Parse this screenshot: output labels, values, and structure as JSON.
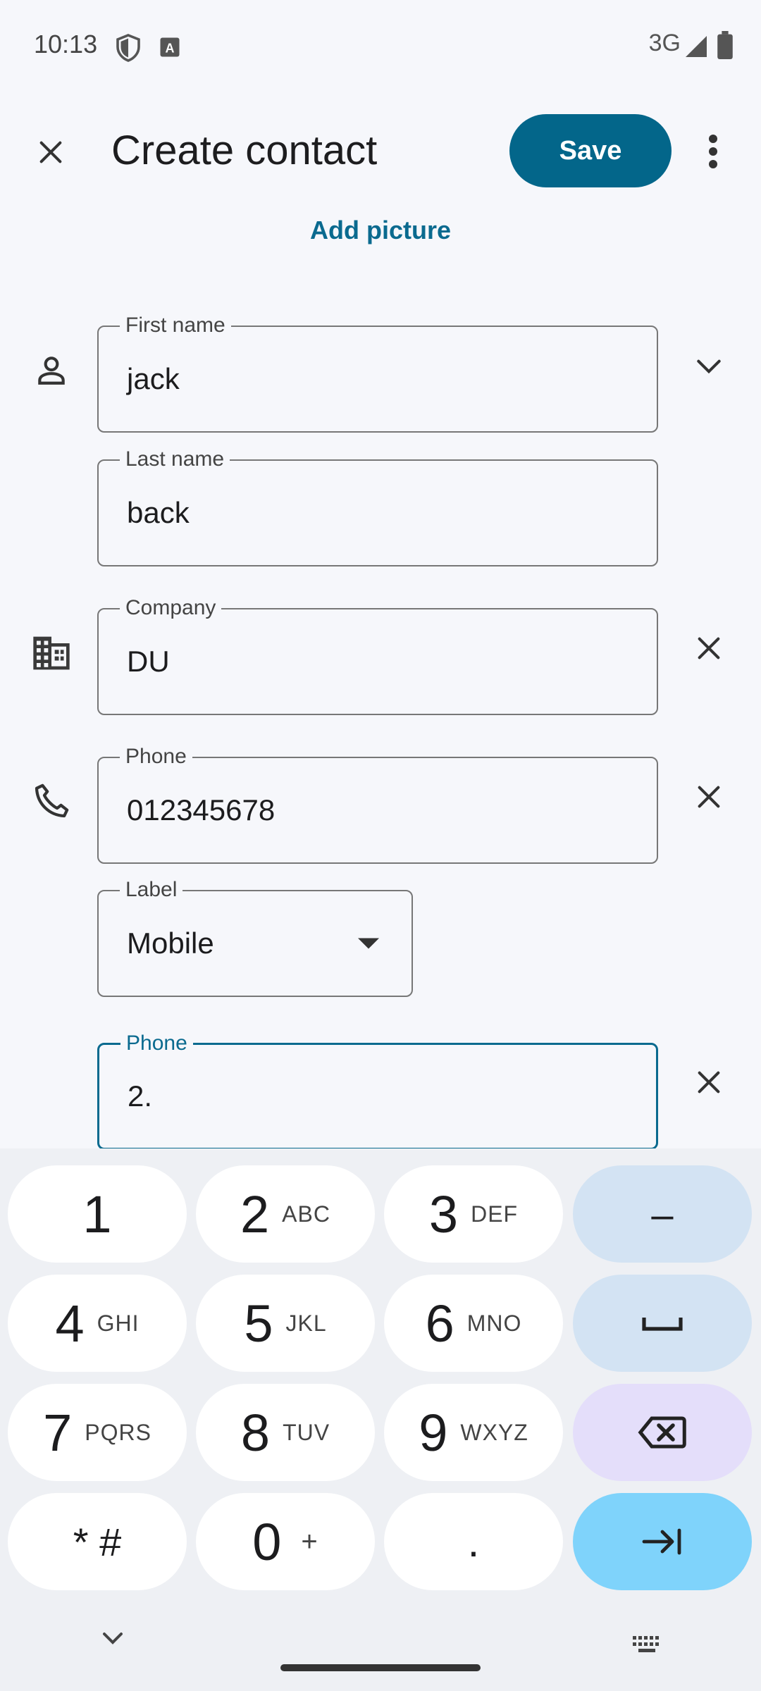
{
  "status_bar": {
    "time": "10:13",
    "network": "3G",
    "icons": [
      "shield-icon",
      "accessibility-a-icon",
      "signal-icon",
      "battery-icon"
    ]
  },
  "app_bar": {
    "title": "Create contact",
    "save_label": "Save",
    "icons": [
      "close-icon",
      "more-vert-icon"
    ]
  },
  "add_picture_label": "Add picture",
  "form": {
    "first_name": {
      "label": "First name",
      "value": "jack"
    },
    "last_name": {
      "label": "Last name",
      "value": "back"
    },
    "company": {
      "label": "Company",
      "value": "DU"
    },
    "phone1": {
      "label": "Phone",
      "value": "012345678"
    },
    "phone1_type": {
      "label": "Label",
      "value": "Mobile"
    },
    "phone2": {
      "label": "Phone",
      "value": "2."
    }
  },
  "keyboard": {
    "rows": [
      [
        {
          "num": "1",
          "sub": ""
        },
        {
          "num": "2",
          "sub": "ABC"
        },
        {
          "num": "3",
          "sub": "DEF"
        },
        {
          "num": "–",
          "sub": ""
        }
      ],
      [
        {
          "num": "4",
          "sub": "GHI"
        },
        {
          "num": "5",
          "sub": "JKL"
        },
        {
          "num": "6",
          "sub": "MNO"
        },
        {
          "num": "",
          "sub": ""
        }
      ],
      [
        {
          "num": "7",
          "sub": "PQRS"
        },
        {
          "num": "8",
          "sub": "TUV"
        },
        {
          "num": "9",
          "sub": "WXYZ"
        },
        {
          "num": "",
          "sub": ""
        }
      ],
      [
        {
          "num": "* #",
          "sub": ""
        },
        {
          "num": "0",
          "sub": "+"
        },
        {
          "num": ".",
          "sub": ""
        },
        {
          "num": "",
          "sub": ""
        }
      ]
    ],
    "colors": {
      "key": "#ffffff",
      "function_key": "#d3e3f3",
      "delete_key": "#e4defa",
      "enter_key": "#7fd3fb"
    }
  },
  "colors": {
    "accent": "#03668a",
    "background": "#f6f7fb"
  }
}
